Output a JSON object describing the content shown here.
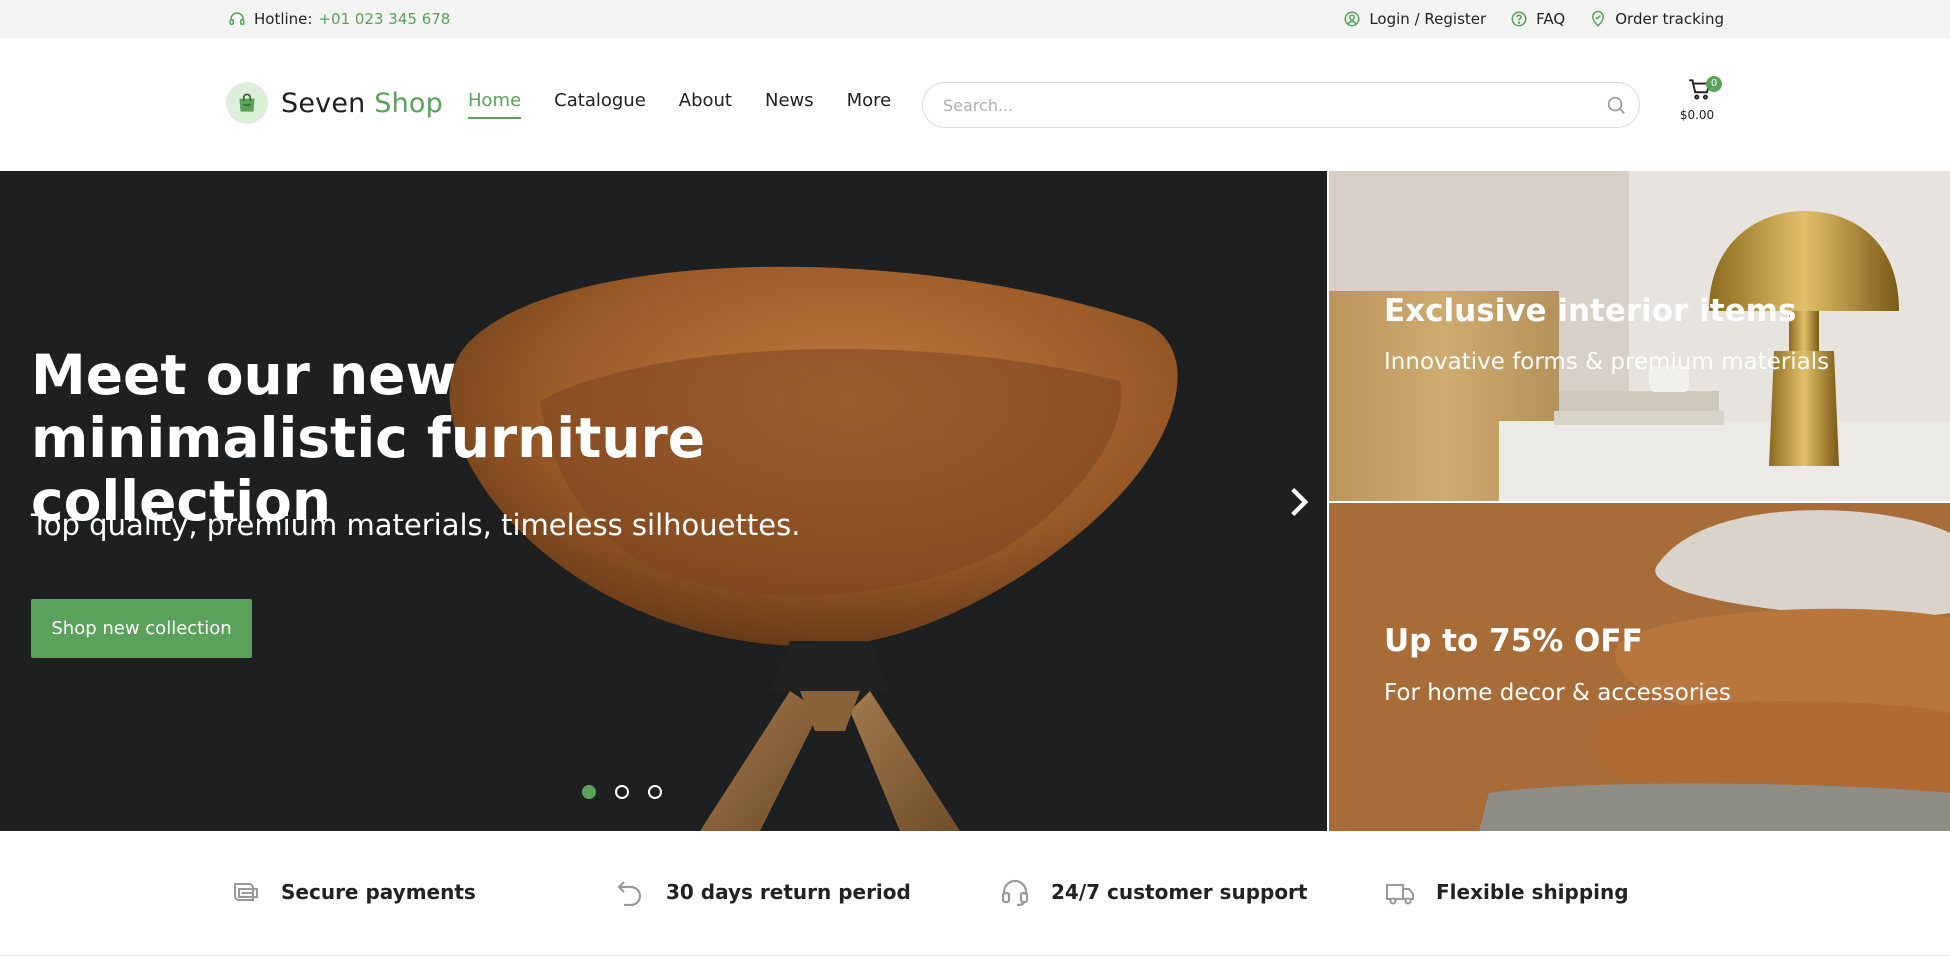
{
  "topbar": {
    "hotline_label": "Hotline:",
    "hotline_number": "+01 023 345 678",
    "links": [
      {
        "label": "Login / Register",
        "icon": "user-circle-icon"
      },
      {
        "label": "FAQ",
        "icon": "question-circle-icon"
      },
      {
        "label": "Order tracking",
        "icon": "location-pin-icon"
      }
    ]
  },
  "header": {
    "brand_main": "Seven",
    "brand_accent": "Shop",
    "nav": [
      "Home",
      "Catalogue",
      "About",
      "News",
      "More"
    ],
    "active_nav": "Home",
    "search_placeholder": "Search...",
    "cart_count": "0",
    "cart_total": "$0.00"
  },
  "hero": {
    "title": "Meet our new minimalistic furniture collection",
    "subtitle": "Top quality, premium materials, timeless silhouettes.",
    "cta": "Shop new collection",
    "slides": 3,
    "active_slide": 1
  },
  "promos": [
    {
      "title": "Exclusive interior items",
      "subtitle": "Innovative forms & premium materials"
    },
    {
      "title": "Up to 75% OFF",
      "subtitle": "For home decor & accessories"
    }
  ],
  "features": [
    {
      "label": "Secure payments",
      "icon": "credit-card-icon"
    },
    {
      "label": "30 days return period",
      "icon": "return-arrow-icon"
    },
    {
      "label": "24/7 customer support",
      "icon": "headset-icon"
    },
    {
      "label": "Flexible shipping",
      "icon": "truck-icon"
    }
  ],
  "colors": {
    "accent": "#5aa25a",
    "topbar_bg": "#f4f4f4",
    "hero_bg": "#1d1f21"
  }
}
